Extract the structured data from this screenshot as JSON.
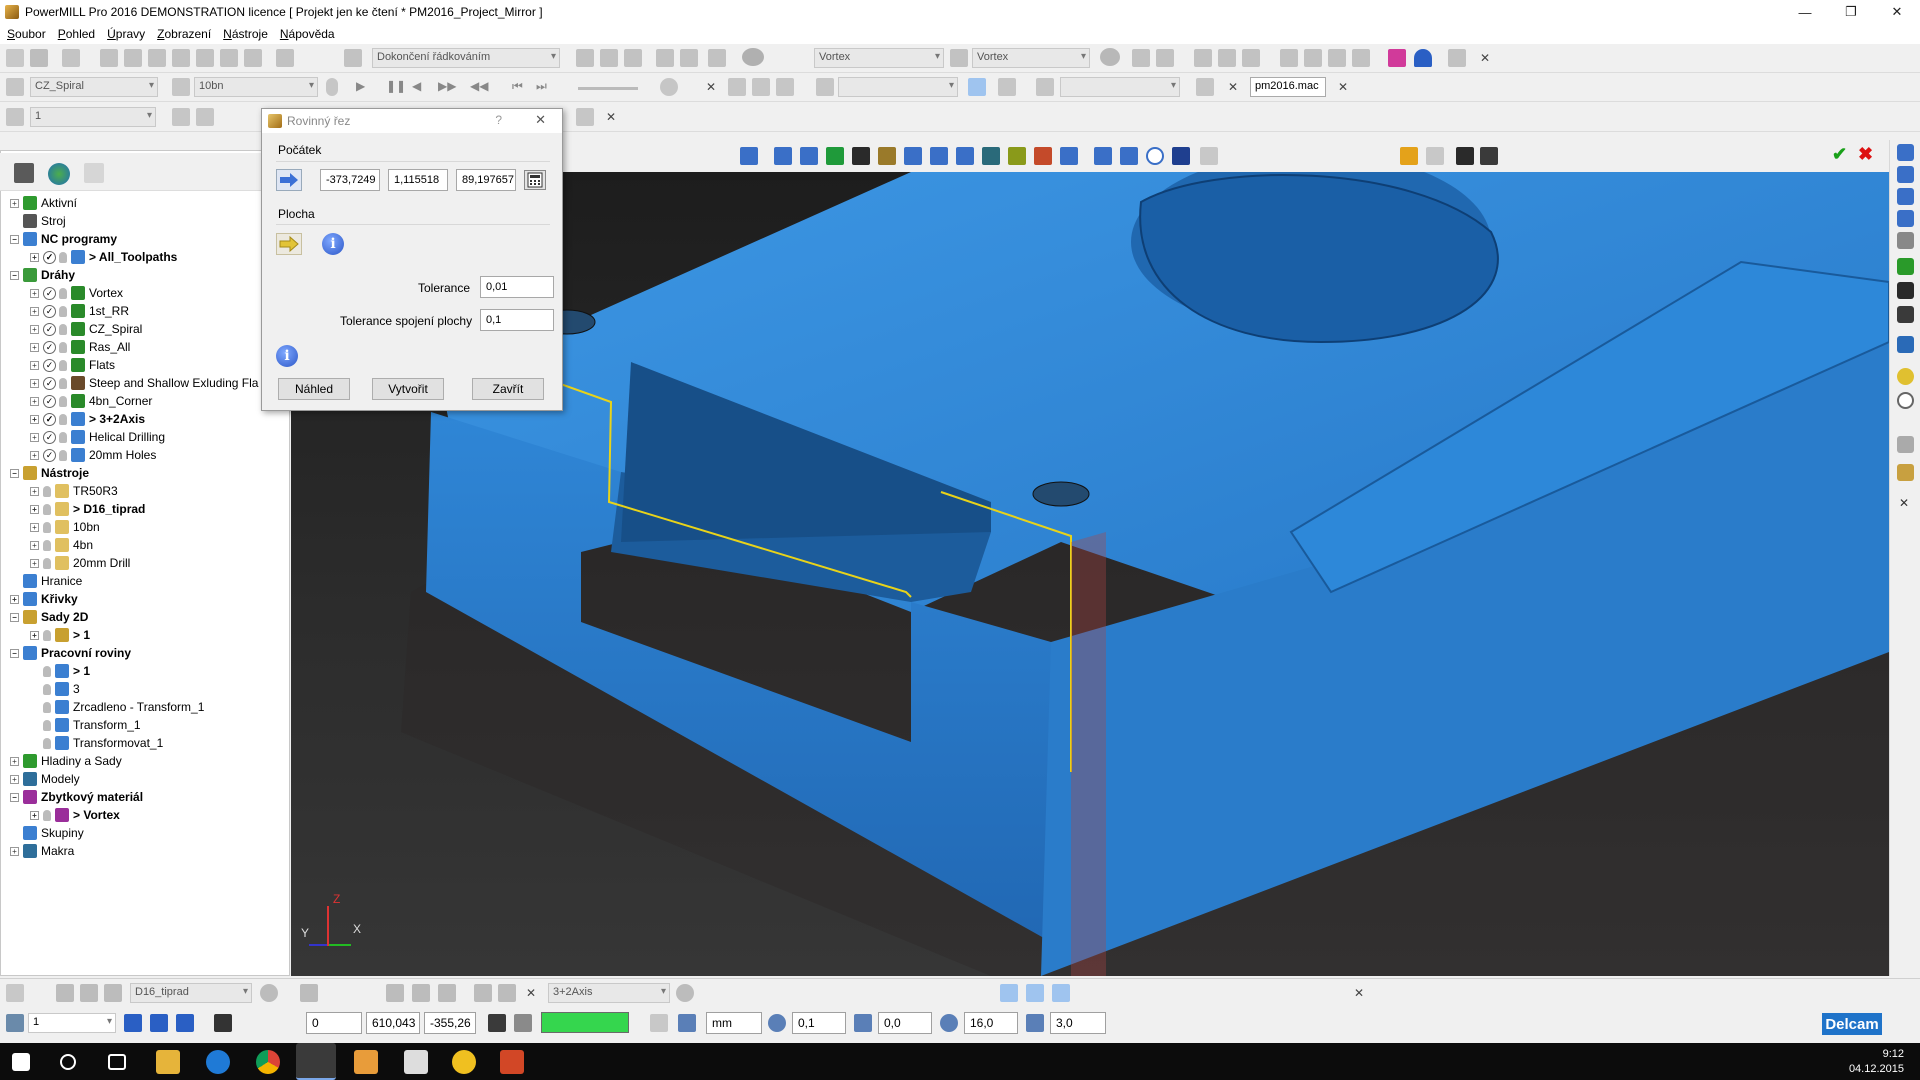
{
  "window": {
    "title": "PowerMILL Pro 2016 DEMONSTRATION licence   [ Projekt jen ke čtení * PM2016_Project_Mirror ]"
  },
  "menu": [
    "Soubor",
    "Pohled",
    "Úpravy",
    "Zobrazení",
    "Nástroje",
    "Nápověda"
  ],
  "toolbar1": {
    "strategy_combo": "Dokončení řádkováním",
    "toolpath_combo1": "Vortex",
    "toolpath_combo2": "Vortex"
  },
  "toolbar2": {
    "toolpath_combo": "CZ_Spiral",
    "tool_combo": "10bn",
    "macro_field": "pm2016.mac"
  },
  "toolbar3": {
    "workplane_combo": "1"
  },
  "dialog": {
    "title": "Rovinný řez",
    "help": "?",
    "section_origin": "Počátek",
    "origin_x": "-373,7249",
    "origin_y": "1,115518",
    "origin_z": "89,197657",
    "section_plane": "Plocha",
    "tolerance_label": "Tolerance",
    "tolerance_value": "0,01",
    "join_tolerance_label": "Tolerance spojení plochy",
    "join_tolerance_value": "0,1",
    "preview_button": "Náhled",
    "create_button": "Vytvořit",
    "close_button": "Zavřít"
  },
  "explorer": {
    "items": [
      {
        "label": "Aktivní",
        "level": 0,
        "expander": "+",
        "icon_color": "#2e9a2e",
        "bold": false
      },
      {
        "label": "Stroj",
        "level": 0,
        "expander": "",
        "icon_color": "#555555",
        "bold": false
      },
      {
        "label": "NC programy",
        "level": 0,
        "expander": "−",
        "icon_color": "#3b7fd1",
        "bold": true
      },
      {
        "label": "> All_Toolpaths",
        "level": 1,
        "expander": "+",
        "icon_color": "#3b7fd1",
        "bold": true,
        "checked": true
      },
      {
        "label": "Dráhy",
        "level": 0,
        "expander": "−",
        "icon_color": "#3a9a3a",
        "bold": true
      },
      {
        "label": "Vortex",
        "level": 1,
        "expander": "+",
        "icon_color": "#2a8a2a",
        "bold": false,
        "checked": true
      },
      {
        "label": "1st_RR",
        "level": 1,
        "expander": "+",
        "icon_color": "#2a8a2a",
        "bold": false,
        "checked": true
      },
      {
        "label": "CZ_Spiral",
        "level": 1,
        "expander": "+",
        "icon_color": "#2a8a2a",
        "bold": false,
        "checked": true
      },
      {
        "label": "Ras_All",
        "level": 1,
        "expander": "+",
        "icon_color": "#2a8a2a",
        "bold": false,
        "checked": true
      },
      {
        "label": "Flats",
        "level": 1,
        "expander": "+",
        "icon_color": "#2a8a2a",
        "bold": false,
        "checked": true
      },
      {
        "label": "Steep and Shallow Exluding Fla",
        "level": 1,
        "expander": "+",
        "icon_color": "#6a4a2a",
        "bold": false,
        "checked": true
      },
      {
        "label": "4bn_Corner",
        "level": 1,
        "expander": "+",
        "icon_color": "#2a8a2a",
        "bold": false,
        "checked": true
      },
      {
        "label": "> 3+2Axis",
        "level": 1,
        "expander": "+",
        "icon_color": "#3b7fd1",
        "bold": true,
        "checked": true
      },
      {
        "label": "Helical Drilling",
        "level": 1,
        "expander": "+",
        "icon_color": "#3b7fd1",
        "bold": false,
        "checked": true
      },
      {
        "label": "20mm Holes",
        "level": 1,
        "expander": "+",
        "icon_color": "#3b7fd1",
        "bold": false,
        "checked": true
      },
      {
        "label": "Nástroje",
        "level": 0,
        "expander": "−",
        "icon_color": "#c8a030",
        "bold": true
      },
      {
        "label": "TR50R3",
        "level": 1,
        "expander": "+",
        "icon_color": "#e0c060",
        "bold": false
      },
      {
        "label": "> D16_tiprad",
        "level": 1,
        "expander": "+",
        "icon_color": "#e0c060",
        "bold": true
      },
      {
        "label": "10bn",
        "level": 1,
        "expander": "+",
        "icon_color": "#e0c060",
        "bold": false
      },
      {
        "label": "4bn",
        "level": 1,
        "expander": "+",
        "icon_color": "#e0c060",
        "bold": false
      },
      {
        "label": "20mm Drill",
        "level": 1,
        "expander": "+",
        "icon_color": "#e0c060",
        "bold": false
      },
      {
        "label": "Hranice",
        "level": 0,
        "expander": "",
        "icon_color": "#3b7fd1",
        "bold": false
      },
      {
        "label": "Křivky",
        "level": 0,
        "expander": "+",
        "icon_color": "#3b7fd1",
        "bold": true
      },
      {
        "label": "Sady 2D",
        "level": 0,
        "expander": "−",
        "icon_color": "#c8a030",
        "bold": true
      },
      {
        "label": "> 1",
        "level": 1,
        "expander": "+",
        "icon_color": "#c8a030",
        "bold": true
      },
      {
        "label": "Pracovní roviny",
        "level": 0,
        "expander": "−",
        "icon_color": "#3b7fd1",
        "bold": true
      },
      {
        "label": "> 1",
        "level": 1,
        "expander": "",
        "icon_color": "#3b7fd1",
        "bold": true
      },
      {
        "label": "3",
        "level": 1,
        "expander": "",
        "icon_color": "#3b7fd1",
        "bold": false
      },
      {
        "label": "Zrcadleno - Transform_1",
        "level": 1,
        "expander": "",
        "icon_color": "#3b7fd1",
        "bold": false
      },
      {
        "label": "Transform_1",
        "level": 1,
        "expander": "",
        "icon_color": "#3b7fd1",
        "bold": false
      },
      {
        "label": "Transformovat_1",
        "level": 1,
        "expander": "",
        "icon_color": "#3b7fd1",
        "bold": false
      },
      {
        "label": "Hladiny a Sady",
        "level": 0,
        "expander": "+",
        "icon_color": "#2e9a2e",
        "bold": false
      },
      {
        "label": "Modely",
        "level": 0,
        "expander": "+",
        "icon_color": "#2e6e9a",
        "bold": false
      },
      {
        "label": "Zbytkový materiál",
        "level": 0,
        "expander": "−",
        "icon_color": "#9a2e9a",
        "bold": true
      },
      {
        "label": "> Vortex",
        "level": 1,
        "expander": "+",
        "icon_color": "#9a2e9a",
        "bold": true
      },
      {
        "label": "Skupiny",
        "level": 0,
        "expander": "",
        "icon_color": "#3b7fd1",
        "bold": false
      },
      {
        "label": "Makra",
        "level": 0,
        "expander": "+",
        "icon_color": "#2e6e9a",
        "bold": false
      }
    ]
  },
  "viewport": {
    "axis_labels": {
      "x": "X",
      "y": "Y",
      "z": "Z"
    },
    "model_color": "#2f86d6"
  },
  "statusbar": {
    "tool_combo": "D16_tiprad",
    "toolpath_combo": "3+2Axis",
    "workplane_combo": "1",
    "coord_0": "0",
    "coord_x": "610,043",
    "coord_y": "-355,26",
    "units": "mm",
    "tolerance": "0,1",
    "thickness": "0,0",
    "diameter": "16,0",
    "stepover": "3,0",
    "brand": "Delcam"
  },
  "taskbar": {
    "time": "9:12",
    "date": "04.12.2015"
  },
  "colors": {
    "accent_green": "#35d64e",
    "model_blue": "#2f86d6",
    "delcam_blue": "#1f73c9"
  }
}
